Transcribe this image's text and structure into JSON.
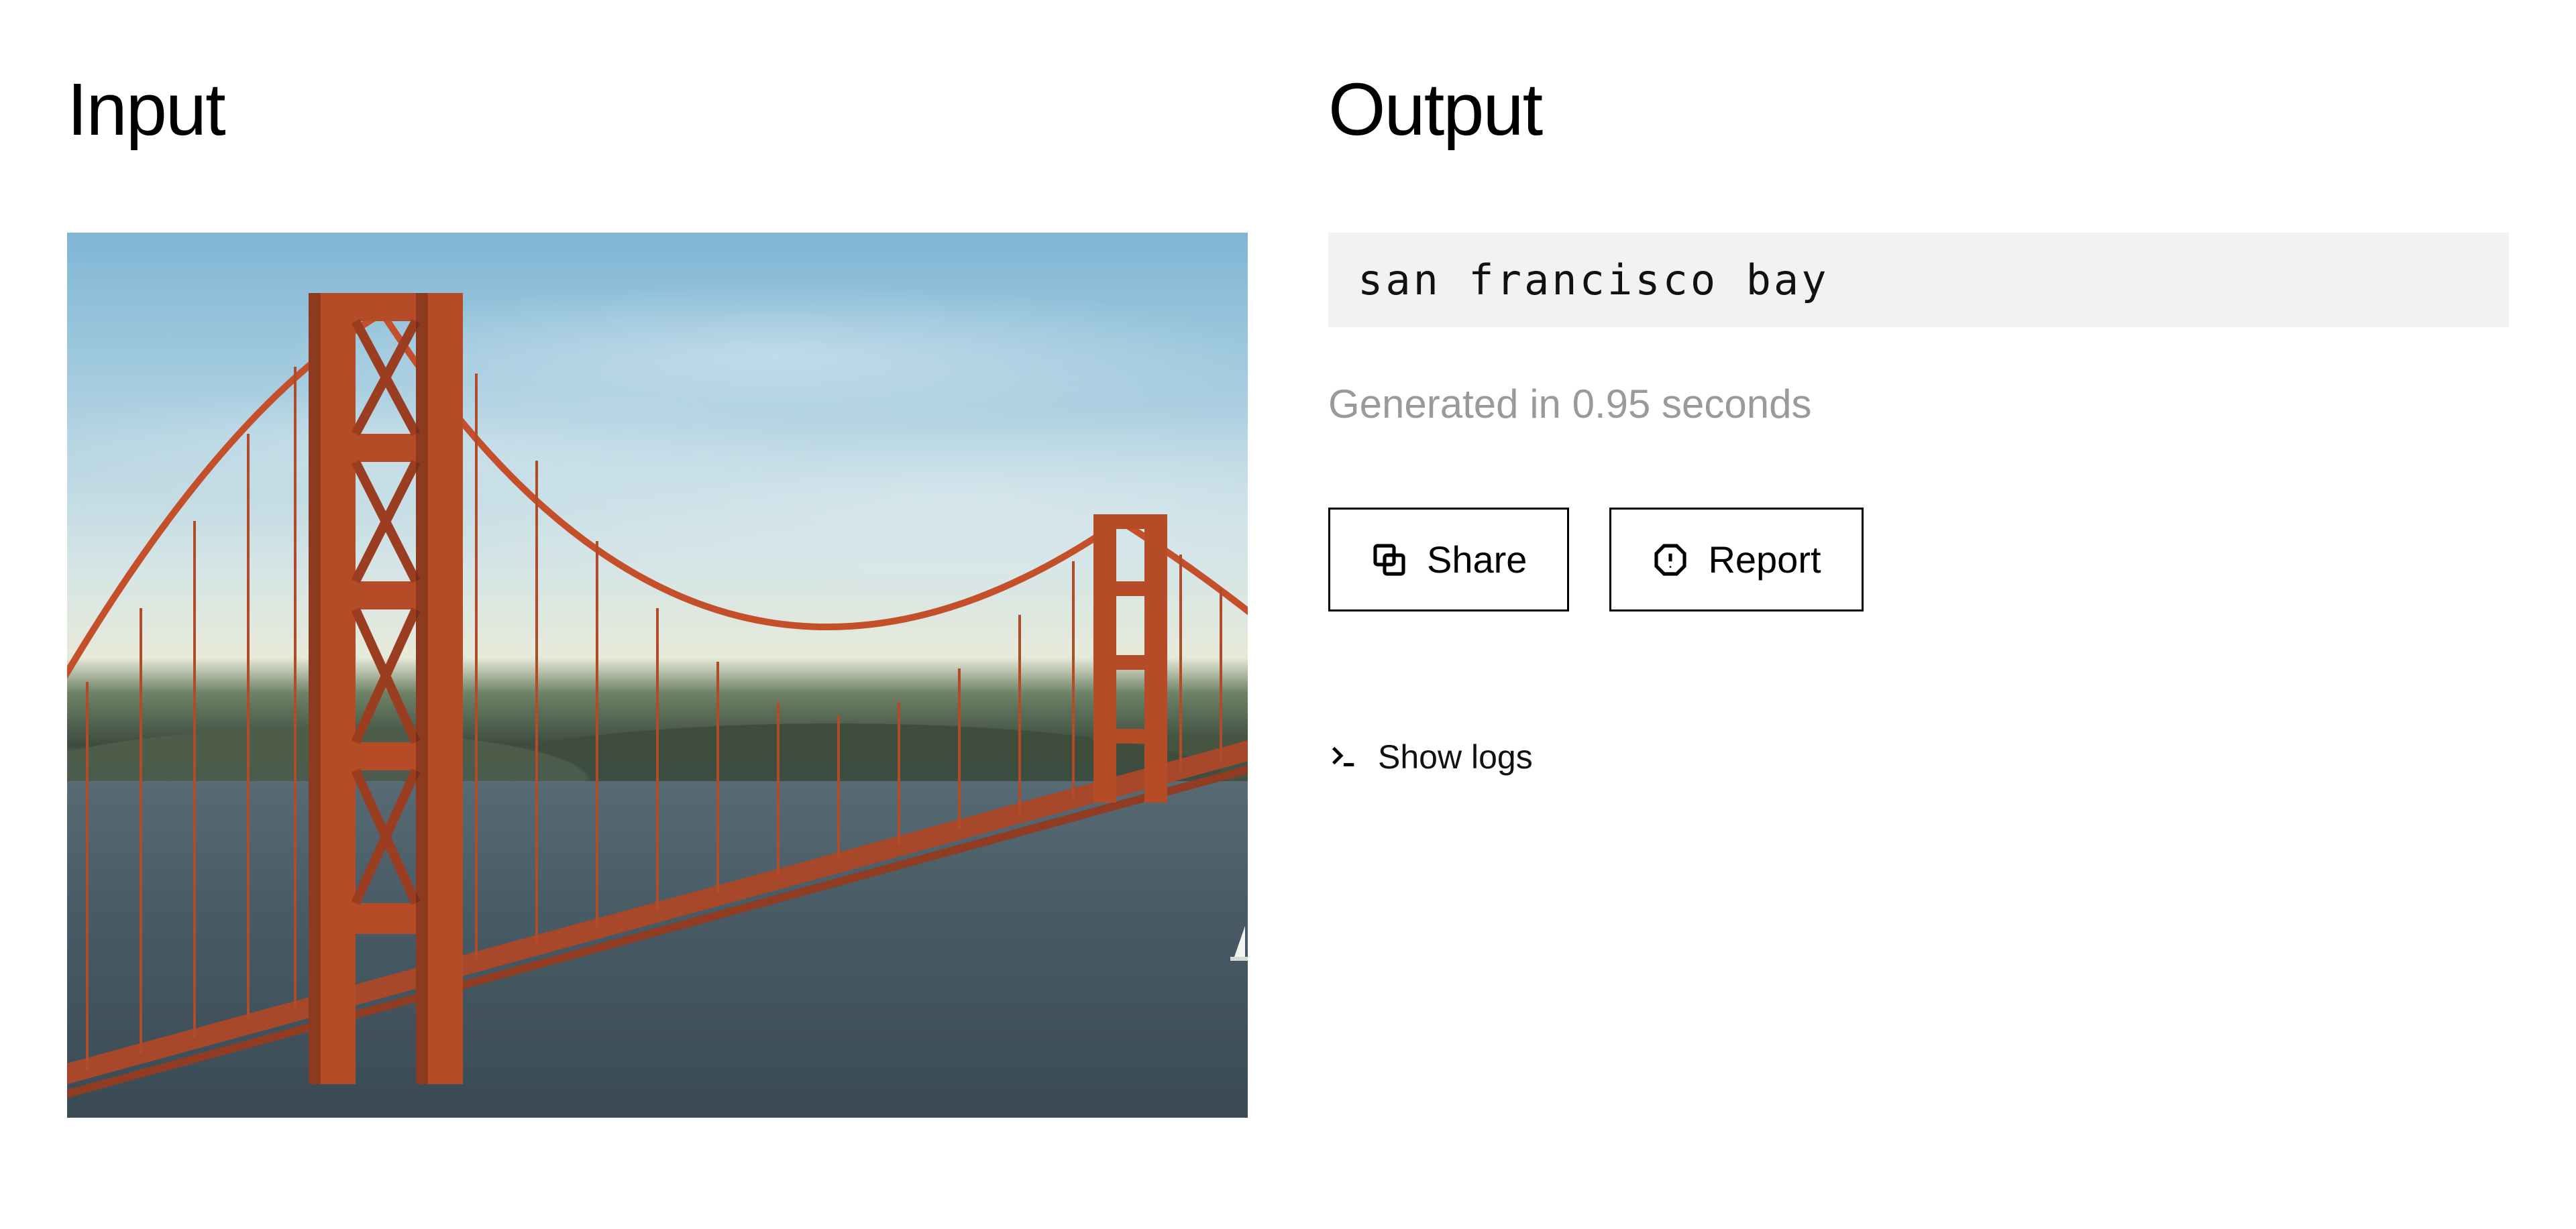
{
  "input": {
    "title": "Input",
    "image_alt": "Golden Gate Bridge over San Francisco Bay"
  },
  "output": {
    "title": "Output",
    "result_text": "san francisco bay",
    "generated_in_label": "Generated in 0.95 seconds",
    "buttons": {
      "share_label": "Share",
      "report_label": "Report"
    },
    "logs_toggle_label": "Show logs"
  }
}
